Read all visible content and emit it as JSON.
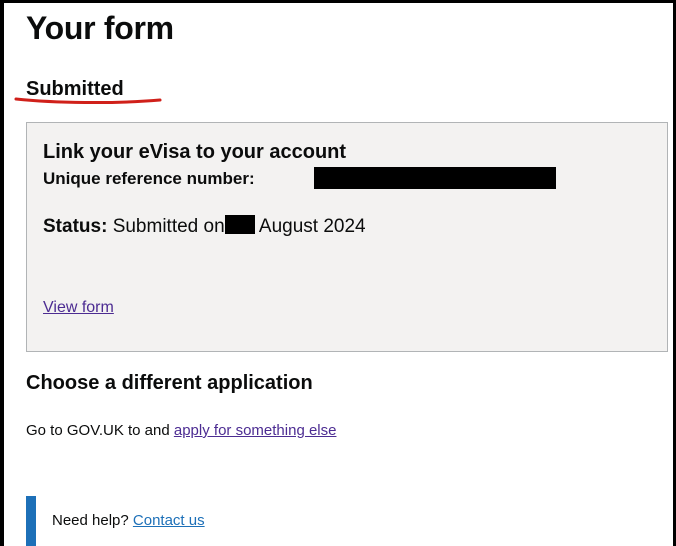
{
  "page": {
    "title": "Your form",
    "status_heading": "Submitted"
  },
  "card": {
    "title": "Link your eVisa to your account",
    "reference_label": "Unique reference number:",
    "status_label": "Status:",
    "status_prefix": "Submitted on",
    "status_suffix": "August 2024",
    "view_link": "View form"
  },
  "alternative": {
    "heading": "Choose a different application",
    "text": "Go to GOV.UK to and",
    "link": "apply for something else"
  },
  "help": {
    "text": "Need help?",
    "link": "Contact us"
  },
  "colors": {
    "annotation_underline": "#d0201a",
    "link_visited": "#4c2c92",
    "link": "#1d70b8",
    "inset_bar": "#1d70b8",
    "card_background": "#f3f2f1"
  }
}
